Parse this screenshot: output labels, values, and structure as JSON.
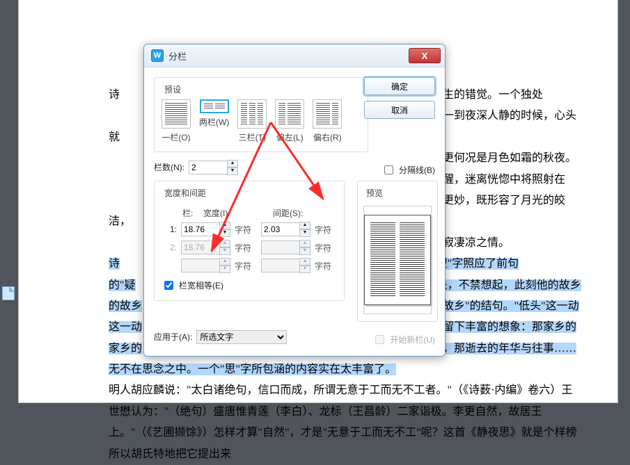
{
  "doc": {
    "p1_a": "间所产生的错觉。一个独处",
    "p1_b": "一到夜深人静的时候，心头就",
    "p1_c": "更何况是月色如霜的秋夜。",
    "p1_d": "醒，迷离恍惚中将照射在",
    "p1_e": "更妙，既形容了月光的皎洁，",
    "p1_f": "寂凄凉之情。",
    "p2_a": "诗",
    "p2_pre": "的\"疑",
    "p2_b": "情。\"望\"字照应了前句",
    "p2_c": "处，不禁想起，此刻他的故乡",
    "p2_d": "思故乡\"的结句。\"低头\"这一动",
    "p2_e": "却留下丰富的想象：那家乡的",
    "p2_f": "友，那逝去的年华与往事……无不在思念之中。一个\"思\"字所包涵的内容实在太丰富了。",
    "p3": "明人胡应麟说：\"太白诸绝句，信口而成，所谓无意于工而无不工者。\"（《诗薮·内编》卷六）王世懋认为：\"（绝句）盛唐惟青莲（李白）、龙标（王昌龄）二家诣极。李更自然，故居王上。\"（《艺圃撷馀》）怎样才算\"自然\"，才是\"无意于工而无不工\"呢？这首《静夜思》就是个样榜  所以胡氏特地把它提出来"
  },
  "dialog": {
    "title": "分栏",
    "ok": "确定",
    "cancel": "取消",
    "preset_title": "预设",
    "presets": {
      "one": "一栏(O)",
      "two": "两栏(W)",
      "three": "三栏(T)",
      "left": "偏左(L)",
      "right": "偏右(R)"
    },
    "cols_label": "栏数(N):",
    "cols_value": "2",
    "sep_label": "分隔线(B)",
    "wd_title": "宽度和间距",
    "preview_title": "预览",
    "col_h": "栏:",
    "width_h": "宽度(I):",
    "space_h": "间距(S):",
    "r1": {
      "n": "1:",
      "w": "18.76",
      "s": "2.03",
      "u": "字符"
    },
    "r2": {
      "n": "2:",
      "w": "18.76",
      "s": "",
      "u": "字符"
    },
    "r3": {
      "n": "",
      "w": "",
      "s": "",
      "u": "字符"
    },
    "equal": "栏宽相等(E)",
    "apply_label": "应用于(A):",
    "apply_value": "所选文字",
    "newcol": "开始新栏(U)"
  }
}
